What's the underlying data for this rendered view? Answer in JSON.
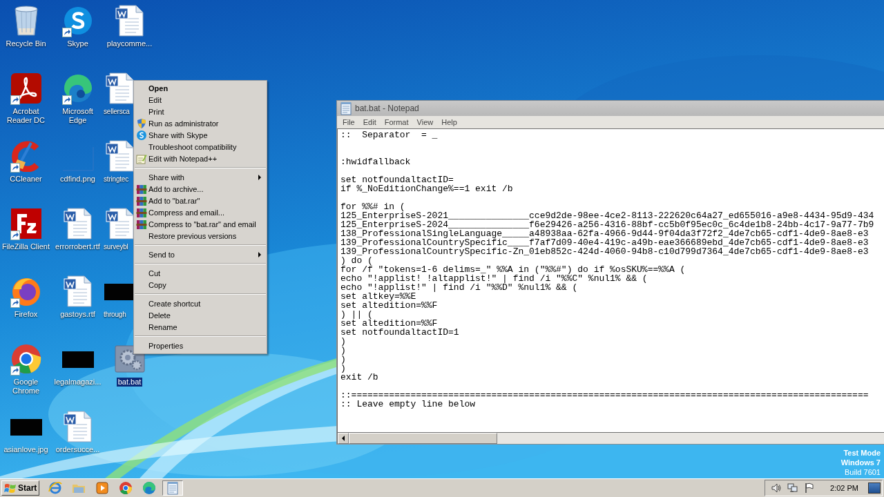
{
  "desktop": {
    "icons": [
      {
        "label": "Recycle Bin",
        "kind": "recycle-bin",
        "shortcut": false,
        "selected": false,
        "covered": false
      },
      {
        "label": "Acrobat Reader DC",
        "kind": "acrobat",
        "shortcut": true,
        "selected": false,
        "covered": false
      },
      {
        "label": "CCleaner",
        "kind": "ccleaner",
        "shortcut": true,
        "selected": false,
        "covered": false
      },
      {
        "label": "FileZilla Client",
        "kind": "filezilla",
        "shortcut": true,
        "selected": false,
        "covered": false
      },
      {
        "label": "Firefox",
        "kind": "firefox",
        "shortcut": true,
        "selected": false,
        "covered": false
      },
      {
        "label": "Google Chrome",
        "kind": "chrome",
        "shortcut": true,
        "selected": false,
        "covered": false
      },
      {
        "label": "asianlove.jpg",
        "kind": "dark-thumb",
        "shortcut": false,
        "selected": false,
        "covered": false
      },
      {
        "label": "Skype",
        "kind": "skype",
        "shortcut": true,
        "selected": false,
        "covered": false
      },
      {
        "label": "Microsoft Edge",
        "kind": "edge",
        "shortcut": true,
        "selected": false,
        "covered": false
      },
      {
        "label": "cdfind.png",
        "kind": "blank-thumb",
        "shortcut": false,
        "selected": false,
        "covered": false
      },
      {
        "label": "errorrobert.rtf",
        "kind": "document",
        "shortcut": false,
        "selected": false,
        "covered": false
      },
      {
        "label": "gastoys.rtf",
        "kind": "document",
        "shortcut": false,
        "selected": false,
        "covered": false
      },
      {
        "label": "legalmagazi...",
        "kind": "dark-thumb",
        "shortcut": false,
        "selected": false,
        "covered": false
      },
      {
        "label": "ordersucce...",
        "kind": "document",
        "shortcut": false,
        "selected": false,
        "covered": false
      },
      {
        "label": "playcomme...",
        "kind": "document",
        "shortcut": false,
        "selected": false,
        "covered": false
      },
      {
        "label": "sellersca",
        "kind": "document",
        "shortcut": false,
        "selected": false,
        "covered": true
      },
      {
        "label": "stringtec",
        "kind": "document",
        "shortcut": false,
        "selected": false,
        "covered": true
      },
      {
        "label": "surveybl",
        "kind": "document",
        "shortcut": false,
        "selected": false,
        "covered": true
      },
      {
        "label": "through",
        "kind": "dark-thumb",
        "shortcut": false,
        "selected": false,
        "covered": true
      },
      {
        "label": "bat.bat",
        "kind": "batch",
        "shortcut": false,
        "selected": true,
        "covered": false
      }
    ]
  },
  "context_menu": {
    "groups": [
      [
        {
          "label": "Open",
          "kind": "default",
          "submenu": false
        },
        {
          "label": "Edit",
          "kind": "plain",
          "submenu": false
        },
        {
          "label": "Print",
          "kind": "plain",
          "submenu": false
        },
        {
          "label": "Run as administrator",
          "kind": "shield",
          "submenu": false
        },
        {
          "label": "Share with Skype",
          "kind": "chat",
          "submenu": false
        },
        {
          "label": "Troubleshoot compatibility",
          "kind": "plain",
          "submenu": false
        },
        {
          "label": "Edit with Notepad++",
          "kind": "editor",
          "submenu": false
        }
      ],
      [
        {
          "label": "Share with",
          "kind": "plain",
          "submenu": true
        },
        {
          "label": "Add to archive...",
          "kind": "archive",
          "submenu": false
        },
        {
          "label": "Add to \"bat.rar\"",
          "kind": "archive",
          "submenu": false
        },
        {
          "label": "Compress and email...",
          "kind": "archive",
          "submenu": false
        },
        {
          "label": "Compress to \"bat.rar\" and email",
          "kind": "archive",
          "submenu": false
        },
        {
          "label": "Restore previous versions",
          "kind": "plain",
          "submenu": false
        }
      ],
      [
        {
          "label": "Send to",
          "kind": "plain",
          "submenu": true
        }
      ],
      [
        {
          "label": "Cut",
          "kind": "plain",
          "submenu": false
        },
        {
          "label": "Copy",
          "kind": "plain",
          "submenu": false
        }
      ],
      [
        {
          "label": "Create shortcut",
          "kind": "plain",
          "submenu": false
        },
        {
          "label": "Delete",
          "kind": "plain",
          "submenu": false
        },
        {
          "label": "Rename",
          "kind": "plain",
          "submenu": false
        }
      ],
      [
        {
          "label": "Properties",
          "kind": "plain",
          "submenu": false
        }
      ]
    ]
  },
  "notepad": {
    "title": "bat.bat - Notepad",
    "menu": [
      "File",
      "Edit",
      "Format",
      "View",
      "Help"
    ],
    "text": "::  Separator  = _\n\n\n:hwidfallback\n\nset notfoundaltactID=\nif %_NoEditionChange%==1 exit /b\n\nfor %%# in (\n125_EnterpriseS-2021_______________cce9d2de-98ee-4ce2-8113-222620c64a27_ed655016-a9e8-4434-95d9-434\n125_EnterpriseS-2024_______________f6e29426-a256-4316-88bf-cc5b0f95ec0c_6c4de1b8-24bb-4c17-9a77-7b9\n138_ProfessionalSingleLanguage_____a48938aa-62fa-4966-9d44-9f04da3f72f2_4de7cb65-cdf1-4de9-8ae8-e3\n139_ProfessionalCountrySpecific____f7af7d09-40e4-419c-a49b-eae366689ebd_4de7cb65-cdf1-4de9-8ae8-e3\n139_ProfessionalCountrySpecific-Zn_01eb852c-424d-4060-94b8-c10d799d7364_4de7cb65-cdf1-4de9-8ae8-e3\n) do (\nfor /f \"tokens=1-6 delims=_\" %%A in (\"%%#\") do if %osSKU%==%%A (\necho \"!applist! !altapplist!\" | find /i \"%%C\" %nul1% && (\necho \"!applist!\" | find /i \"%%D\" %nul1% && (\nset altkey=%%E\nset altedition=%%F\n) || (\nset altedition=%%F\nset notfoundaltactID=1\n)\n)\n)\n)\nexit /b\n\n::================================================================================================\n:: Leave empty line below"
  },
  "os_notice": [
    "Test Mode",
    "Windows 7",
    "Build 7601"
  ],
  "taskbar": {
    "start": "Start",
    "apps": [
      {
        "kind": "ie",
        "active": false
      },
      {
        "kind": "folder",
        "active": false
      },
      {
        "kind": "media",
        "active": false
      },
      {
        "kind": "chrome",
        "active": false
      },
      {
        "kind": "edge",
        "active": false
      },
      {
        "kind": "notepad",
        "active": true
      }
    ],
    "tray": [
      {
        "kind": "speaker"
      },
      {
        "kind": "network"
      },
      {
        "kind": "flag"
      }
    ],
    "clock": "2:02 PM"
  }
}
